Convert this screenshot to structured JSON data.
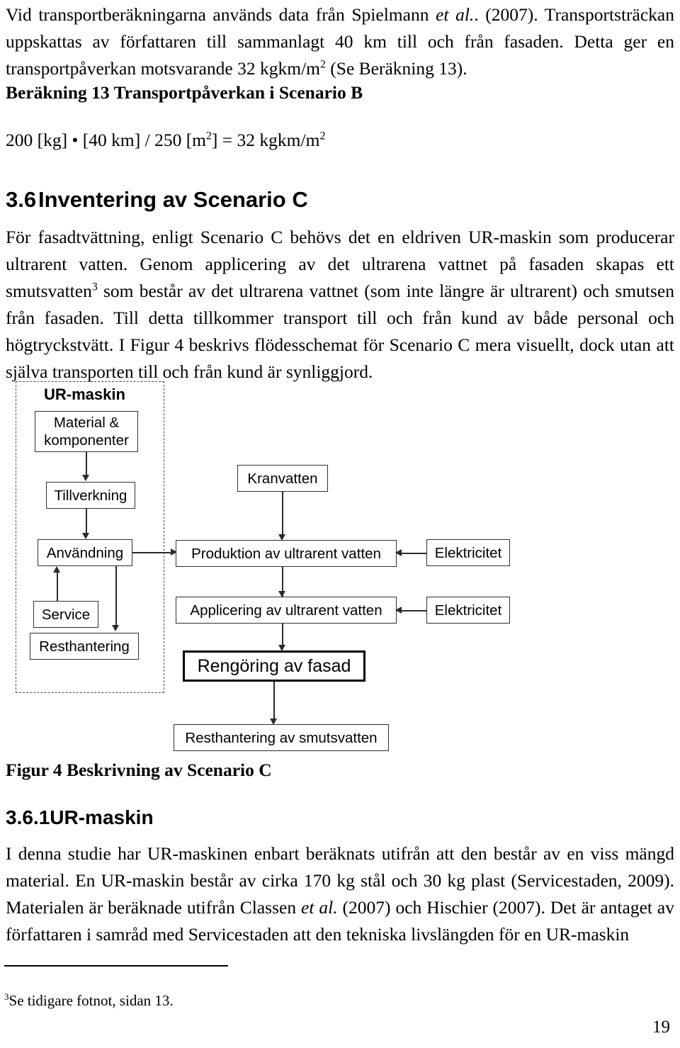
{
  "document": {
    "page_number": "19"
  },
  "paragraph_1": {
    "segments": [
      "Vid transportberäkningarna används data från Spielmann ",
      "et al.",
      ". (2007). Transportsträckan uppskattas av författaren till sammanlagt 40 km till och från fasaden. Detta ger en transportpåverkan motsvarande 32 kgkm/m",
      "2",
      " (Se Beräkning 13)."
    ]
  },
  "calculation": {
    "heading": "Beräkning 13 Transportpåverkan i Scenario B",
    "formula_parts": {
      "p1": "200 [kg] • [40 km] / 250 [m",
      "sup1": "2",
      "p2": "] = 32 kgkm/m",
      "sup2": "2"
    }
  },
  "section_3_6": {
    "number": "3.6",
    "title": "Inventering av Scenario C"
  },
  "paragraph_2": {
    "segments": [
      "För fasadtvättning, enligt Scenario C behövs det en eldriven UR-maskin som producerar ultrarent vatten. Genom applicering av det ultrarena vattnet på fasaden skapas ett smutsvatten",
      "3",
      " som består av det ultrarena vattnet (som inte längre är ultrarent) och smutsen från fasaden. Till detta tillkommer transport till och från kund av både personal och högtryckstvätt. I Figur 4 beskrivs flödesschemat för Scenario C mera visuellt, dock utan att själva transporten till och från kund är synliggjord."
    ]
  },
  "figure": {
    "caption": "Figur 4 Beskrivning av Scenario C",
    "group_label": "UR-maskin",
    "nodes": {
      "material": "Material & komponenter",
      "tillverkning": "Tillverkning",
      "anvandning": "Användning",
      "service": "Service",
      "resthantering": "Resthantering",
      "kranvatten": "Kranvatten",
      "produktion": "Produktion av ultrarent vatten",
      "elektricitet_1": "Elektricitet",
      "applicering": "Applicering av ultrarent vatten",
      "elektricitet_2": "Elektricitet",
      "rengoring": "Rengöring av fasad",
      "resthantering_smutsvatten": "Resthantering av smutsvatten"
    }
  },
  "section_3_6_1": {
    "number": "3.6.1",
    "title": "UR-maskin"
  },
  "paragraph_3": {
    "segments": [
      "I denna studie har UR-maskinen enbart beräknats utifrån att den består av en viss mängd material. En UR-maskin består av cirka 170 kg stål och 30 kg plast (Servicestaden, 2009). Materialen är beräknade utifrån Classen ",
      "et al.",
      " (2007) och Hischier (2007). Det är antaget av författaren i samråd med Servicestaden att den tekniska livslängden för en UR-maskin"
    ]
  },
  "footnote": {
    "marker": "3",
    "text": "Se tidigare fotnot, sidan 13."
  }
}
